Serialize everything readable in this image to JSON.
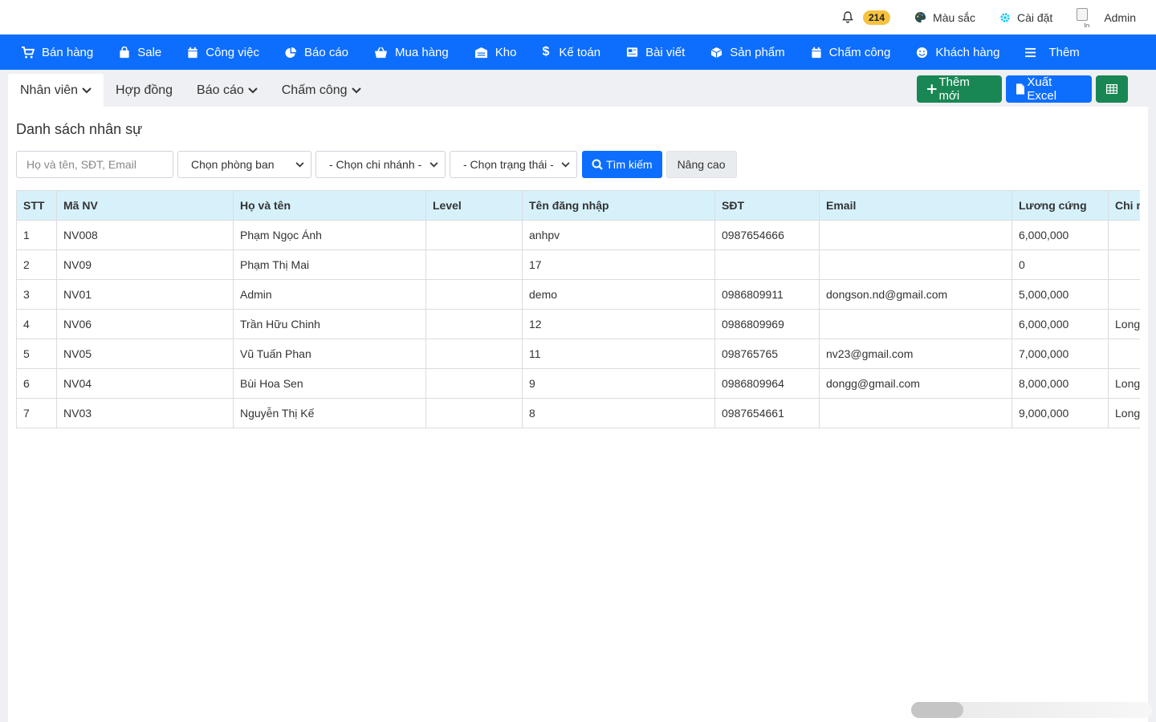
{
  "topbar": {
    "notification_count": "214",
    "color_label": "Màu sắc",
    "settings_label": "Cài đặt",
    "avatar_alt": "lo",
    "user_name": "Admin"
  },
  "nav": [
    {
      "label": "Bán hàng",
      "icon": "cart-icon"
    },
    {
      "label": "Sale",
      "icon": "bag-icon"
    },
    {
      "label": "Công việc",
      "icon": "calendar-icon"
    },
    {
      "label": "Báo cáo",
      "icon": "pie-chart-icon"
    },
    {
      "label": "Mua hàng",
      "icon": "basket-icon"
    },
    {
      "label": "Kho",
      "icon": "warehouse-icon"
    },
    {
      "label": "Kế toán",
      "icon": "dollar-icon"
    },
    {
      "label": "Bài viết",
      "icon": "newspaper-icon"
    },
    {
      "label": "Sản phẩm",
      "icon": "box-icon"
    },
    {
      "label": "Chấm công",
      "icon": "calendar-icon"
    },
    {
      "label": "Khách hàng",
      "icon": "smile-icon"
    },
    {
      "label": "Thêm",
      "icon": "menu-icon"
    }
  ],
  "tabs": {
    "t0": "Nhân viên",
    "t1": "Hợp đồng",
    "t2": "Báo cáo",
    "t3": "Chấm công"
  },
  "actions": {
    "add_label": "Thêm mới",
    "export_label": "Xuất Excel"
  },
  "page": {
    "title": "Danh sách nhân sự"
  },
  "filters": {
    "search_placeholder": "Họ và tên, SĐT, Email",
    "department": "Chọn phòng ban",
    "branch": "- Chọn chi nhánh -",
    "status": "- Chọn trạng thái -",
    "search_button": "Tìm kiếm",
    "advanced_button": "Nâng cao"
  },
  "table": {
    "headers": [
      "STT",
      "Mã NV",
      "Họ và tên",
      "Level",
      "Tên đăng nhập",
      "SĐT",
      "Email",
      "Lương cứng",
      "Chi nhánh"
    ],
    "rows": [
      [
        "1",
        "NV008",
        "Phạm Ngọc Ánh",
        "",
        "anhpv",
        "0987654666",
        "",
        "6,000,000",
        ""
      ],
      [
        "2",
        "NV09",
        "Phạm Thị Mai",
        "",
        "17",
        "",
        "",
        "0",
        ""
      ],
      [
        "3",
        "NV01",
        "Admin",
        "",
        "demo",
        "0986809911",
        "dongson.nd@gmail.com",
        "5,000,000",
        ""
      ],
      [
        "4",
        "NV06",
        "Trần Hữu Chinh",
        "",
        "12",
        "0986809969",
        "",
        "6,000,000",
        "Long"
      ],
      [
        "5",
        "NV05",
        "Vũ Tuấn Phan",
        "",
        "11",
        "098765765",
        "nv23@gmail.com",
        "7,000,000",
        ""
      ],
      [
        "6",
        "NV04",
        "Bùi Hoa Sen",
        "",
        "9",
        "0986809964",
        "dongg@gmail.com",
        "8,000,000",
        "Long"
      ],
      [
        "7",
        "NV03",
        "Nguyễn Thị Kế",
        "",
        "8",
        "0987654661",
        "",
        "9,000,000",
        "Long"
      ]
    ]
  },
  "colors": {
    "primary": "#0d6efd",
    "success": "#198754",
    "header_bg": "#d7f1fb",
    "badge": "#f6c23e"
  }
}
